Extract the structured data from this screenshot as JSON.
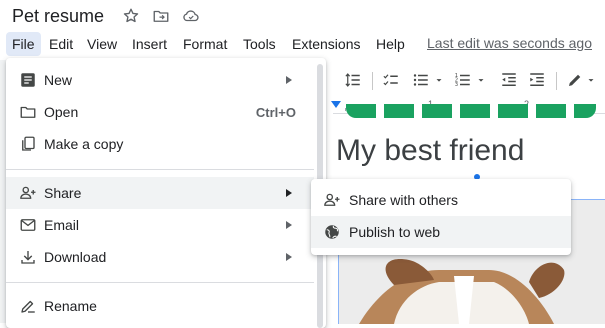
{
  "document": {
    "title": "Pet resume",
    "heading": "My best friend"
  },
  "menubar": {
    "items": [
      "File",
      "Edit",
      "View",
      "Insert",
      "Format",
      "Tools",
      "Extensions",
      "Help"
    ],
    "last_edit": "Last edit was seconds ago"
  },
  "file_menu": {
    "items": [
      {
        "label": "New",
        "icon": "new-document-icon",
        "submenu": true
      },
      {
        "label": "Open",
        "icon": "folder-icon",
        "shortcut": "Ctrl+O"
      },
      {
        "label": "Make a copy",
        "icon": "copy-icon"
      },
      {
        "label": "Share",
        "icon": "person-add-icon",
        "submenu": true,
        "highlighted": true
      },
      {
        "label": "Email",
        "icon": "email-icon",
        "submenu": true
      },
      {
        "label": "Download",
        "icon": "download-icon",
        "submenu": true
      },
      {
        "label": "Rename",
        "icon": "rename-icon"
      }
    ]
  },
  "share_submenu": {
    "items": [
      {
        "label": "Share with others",
        "icon": "person-add-icon"
      },
      {
        "label": "Publish to web",
        "icon": "globe-icon",
        "highlighted": true
      }
    ]
  },
  "ruler": {
    "marks": [
      "1",
      "2"
    ]
  },
  "colors": {
    "accent": "#1a73e8",
    "active_menu_bg": "#e1e9f7",
    "hover_bg": "#f1f3f4",
    "heading_green": "#1aa260"
  }
}
